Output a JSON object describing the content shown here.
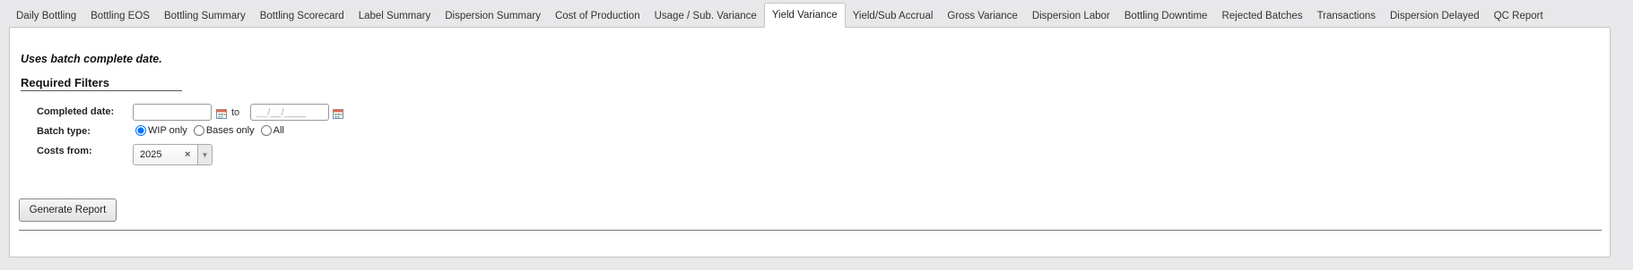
{
  "tabs": [
    {
      "label": "Daily Bottling",
      "active": false
    },
    {
      "label": "Bottling EOS",
      "active": false
    },
    {
      "label": "Bottling Summary",
      "active": false
    },
    {
      "label": "Bottling Scorecard",
      "active": false
    },
    {
      "label": "Label Summary",
      "active": false
    },
    {
      "label": "Dispersion Summary",
      "active": false
    },
    {
      "label": "Cost of Production",
      "active": false
    },
    {
      "label": "Usage / Sub. Variance",
      "active": false
    },
    {
      "label": "Yield Variance",
      "active": true
    },
    {
      "label": "Yield/Sub Accrual",
      "active": false
    },
    {
      "label": "Gross Variance",
      "active": false
    },
    {
      "label": "Dispersion Labor",
      "active": false
    },
    {
      "label": "Bottling Downtime",
      "active": false
    },
    {
      "label": "Rejected Batches",
      "active": false
    },
    {
      "label": "Transactions",
      "active": false
    },
    {
      "label": "Dispersion Delayed",
      "active": false
    },
    {
      "label": "QC Report",
      "active": false
    }
  ],
  "form": {
    "note": "Uses batch complete date.",
    "section_title": "Required Filters",
    "completed_date": {
      "label": "Completed date:",
      "from_value": "",
      "to_text": "to",
      "to_placeholder": "__/__/____",
      "calendar_icon": "calendar-icon"
    },
    "batch_type": {
      "label": "Batch type:",
      "options": [
        "WIP only",
        "Bases only",
        "All"
      ],
      "selected": "WIP only"
    },
    "costs_from": {
      "label": "Costs from:",
      "value": "2025",
      "clear_glyph": "×",
      "arrow_glyph": "▼"
    },
    "generate_button": "Generate Report"
  },
  "colors": {
    "accent": "#1a73e8",
    "page_bg": "#e8e8ea",
    "panel_bg": "#ffffff"
  }
}
